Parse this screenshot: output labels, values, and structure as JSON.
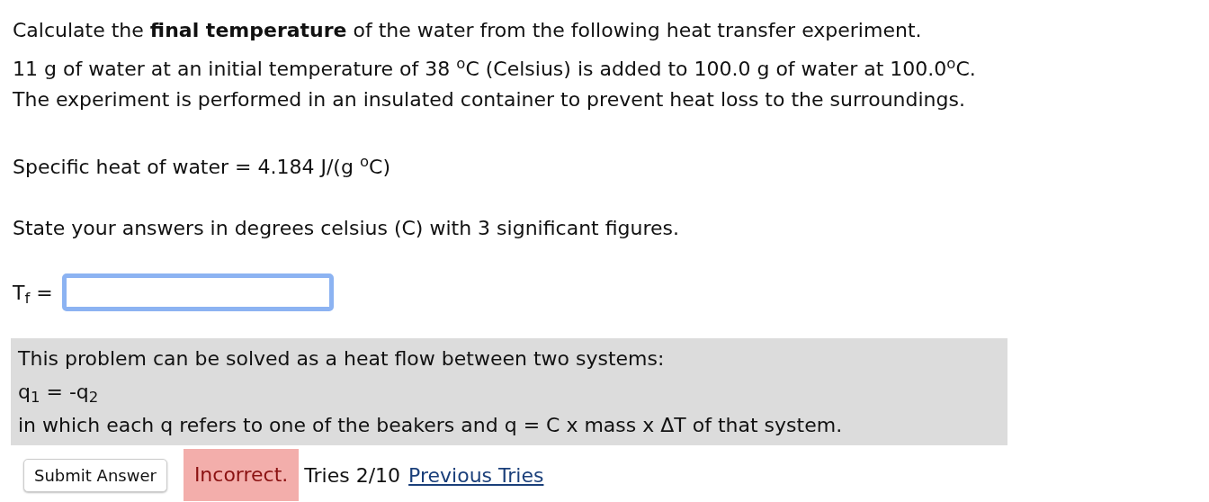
{
  "question": "Calculate the **final temperature** of the water from the following heat transfer experiment.",
  "setup": [
    "11 g of water at an initial temperature of 38 $^{o}$C (Celsius) is added to 100.0 g of water at 100.0$^{o}$C.",
    "The experiment is performed in an insulated container to prevent heat loss to the surroundings."
  ],
  "given": "Specific heat of water = 4.184 J/(g $^{o}$C)",
  "instruction": "State your answers in degrees celsius (C) with 3 significant figures.",
  "answer": {
    "label": "T$_{f}$ =",
    "focused": true
  },
  "hint": [
    "This problem can be solved as a heat flow between two systems:",
    "q$_{1}$ = -q$_{2}$",
    "in which each q refers to one of the beakers and q = C x mass x ΔT of that system."
  ],
  "submit_button": "Submit Answer",
  "status": {
    "kind": "incorrect",
    "text": "Incorrect."
  },
  "tries": "Tries 2/10",
  "previous_tries_link": "Previous Tries"
}
